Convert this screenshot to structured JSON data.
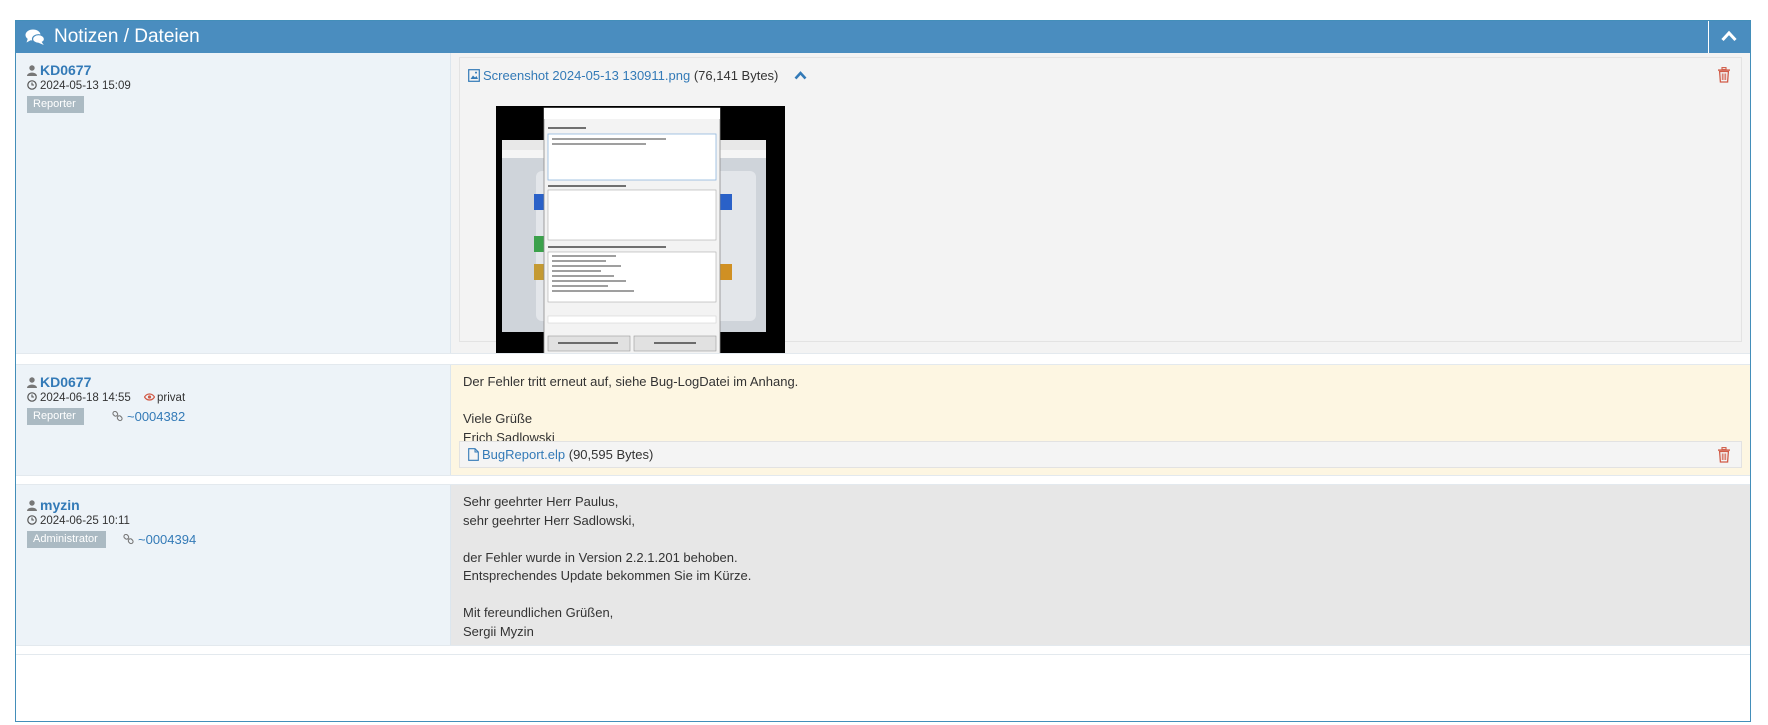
{
  "panel": {
    "title": "Notizen / Dateien"
  },
  "notes": [
    {
      "author": "KD0677",
      "date": "2024-05-13 15:09",
      "role": "Reporter",
      "attachment": {
        "name": "Screenshot 2024-05-13 130911.png",
        "size": "(76,141 Bytes)"
      }
    },
    {
      "author": "KD0677",
      "date": "2024-06-18 14:55",
      "privacy": "privat",
      "role": "Reporter",
      "ref": "~0004382",
      "lines": [
        "Der Fehler tritt erneut auf, siehe Bug-LogDatei im Anhang.",
        "",
        "Viele Grüße",
        "Erich Sadlowski"
      ],
      "attachment": {
        "name": "BugReport.elp",
        "size": "(90,595 Bytes)"
      }
    },
    {
      "author": "myzin",
      "date": "2024-06-25 10:11",
      "role": "Administrator",
      "ref": "~0004394",
      "lines": [
        "Sehr geehrter Herr Paulus,",
        "sehr geehrter Herr Sadlowski,",
        "",
        "der Fehler wurde in Version 2.2.1.201 behoben.",
        "Entsprechendes Update bekommen Sie im Kürze.",
        "",
        "Mit fereundlichen Grüßen,",
        "Sergii Myzin"
      ]
    }
  ],
  "colors": {
    "header": "#4a8dbf",
    "link": "#337ab7",
    "role_badge": "#abbac3",
    "private_note_bg": "#fdf6e2",
    "admin_note_bg": "#e7e7e7",
    "left_col_bg": "#edf3f8",
    "trash": "#d15b47"
  },
  "icons": {
    "header": "comments-icon",
    "collapse": "chevron-up-icon",
    "author": "user-icon",
    "date": "clock-icon",
    "private": "eye-icon",
    "ref": "link-icon",
    "image_file": "image-file-icon",
    "file": "file-icon",
    "delete": "trash-icon"
  }
}
